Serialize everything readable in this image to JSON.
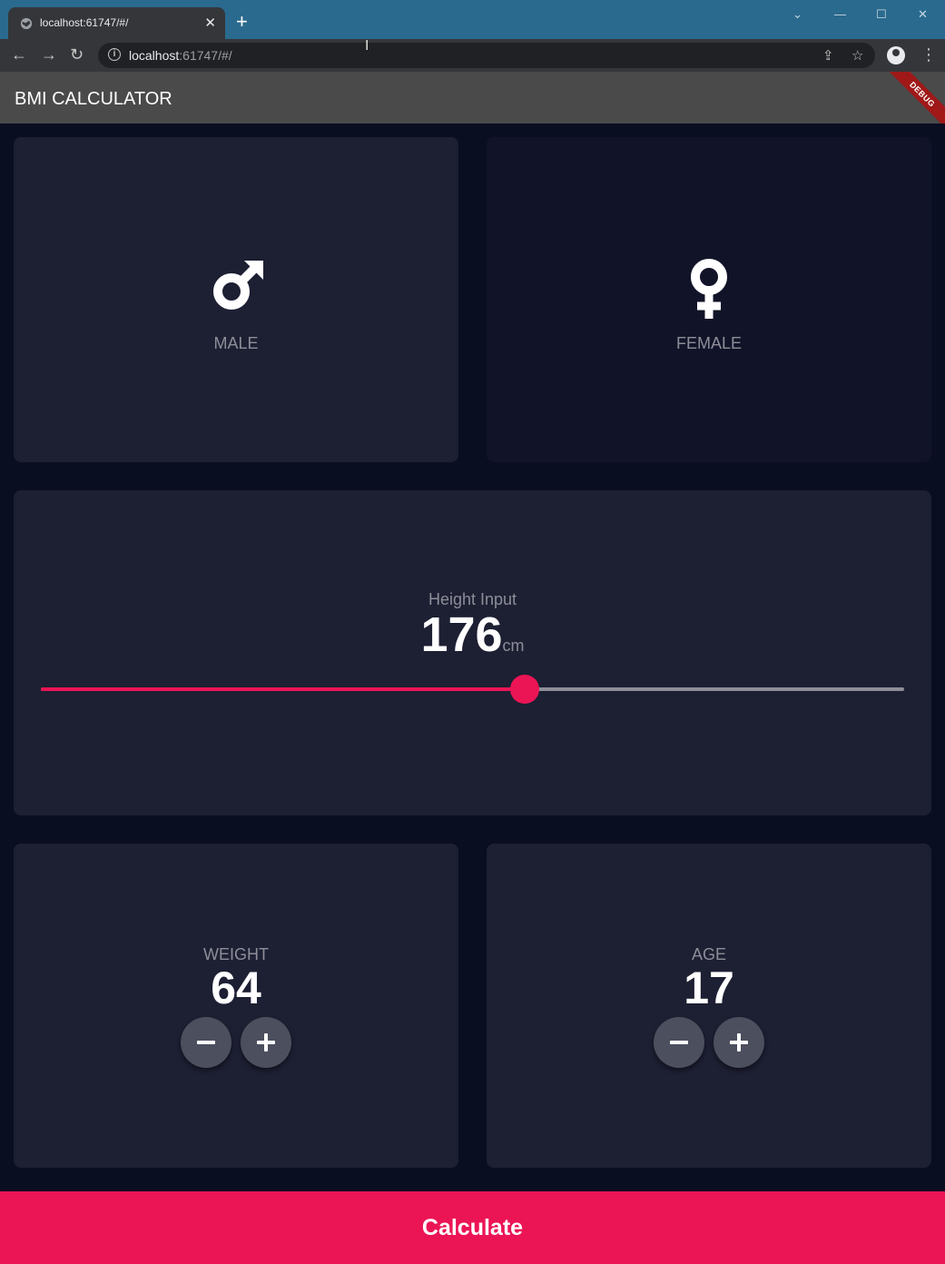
{
  "browser": {
    "tab_title": "localhost:61747/#/",
    "new_tab": "+",
    "tab_close": "✕",
    "url_host": "localhost",
    "url_rest": ":61747/#/",
    "back": "←",
    "forward": "→",
    "reload": "↻",
    "info_icon": "i",
    "share_icon": "⇪",
    "star_icon": "☆",
    "menu_icon": "⋮",
    "win_chevron": "⌄",
    "win_minimize": "—",
    "win_maximize": "☐",
    "win_close": "✕"
  },
  "appbar": {
    "title": "BMI CALCULATOR",
    "debug": "DEBUG"
  },
  "gender": {
    "male_label": "MALE",
    "female_label": "FEMALE",
    "selected": "male"
  },
  "height": {
    "label": "Height Input",
    "value": "176",
    "unit": "cm",
    "slider_fraction": 0.56
  },
  "weight": {
    "label": "WEIGHT",
    "value": "64"
  },
  "age": {
    "label": "AGE",
    "value": "17"
  },
  "calculate": {
    "label": "Calculate"
  },
  "colors": {
    "background": "#0a0e21",
    "active_card": "#1d1f33",
    "inactive_card": "#111328",
    "accent": "#eb1555",
    "label": "#8d8e98",
    "round_button": "#4c4f5e"
  }
}
